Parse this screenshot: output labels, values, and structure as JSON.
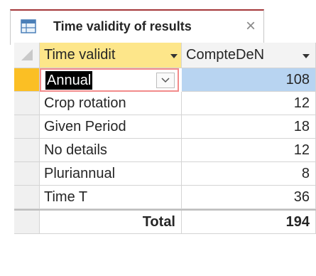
{
  "tab": {
    "title": "Time validity of results",
    "close_label": "×"
  },
  "grid": {
    "columns": [
      "Time validit",
      "CompteDeN"
    ],
    "rows": [
      {
        "label": "Annual",
        "count": "108"
      },
      {
        "label": "Crop rotation",
        "count": "12"
      },
      {
        "label": "Given Period",
        "count": "18"
      },
      {
        "label": "No details",
        "count": "12"
      },
      {
        "label": "Pluriannual",
        "count": "8"
      },
      {
        "label": "Time T",
        "count": "36"
      }
    ],
    "total": {
      "label": "Total",
      "count": "194"
    }
  },
  "icons": {
    "tab_icon": "table-icon",
    "header_dropdown": "chevron-down-icon",
    "combo_dropdown": "chevron-down-icon"
  },
  "colors": {
    "accent_tab": "#a4373a",
    "header_highlight": "#fde68a",
    "row_selector_current": "#fbbf24",
    "selected_cell": "#b8d4f1"
  }
}
